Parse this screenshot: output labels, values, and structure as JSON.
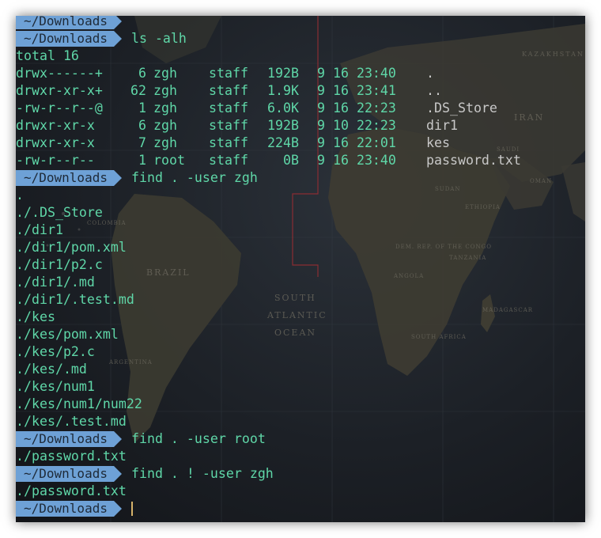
{
  "window": {
    "title": ""
  },
  "prompt": {
    "label": "~/Downloads"
  },
  "lines": [
    {
      "kind": "prompt",
      "command": ""
    },
    {
      "kind": "prompt",
      "command": "ls -alh"
    },
    {
      "kind": "text",
      "text": "total 16"
    },
    {
      "kind": "ls",
      "perm": "drwx------+",
      "links": "6",
      "user": "zgh",
      "group": "staff",
      "size": "192B",
      "date": "9 16 23:40",
      "name": "."
    },
    {
      "kind": "ls",
      "perm": "drwxr-xr-x+",
      "links": "62",
      "user": "zgh",
      "group": "staff",
      "size": "1.9K",
      "date": "9 16 23:41",
      "name": ".."
    },
    {
      "kind": "ls",
      "perm": "-rw-r--r--@",
      "links": "1",
      "user": "zgh",
      "group": "staff",
      "size": "6.0K",
      "date": "9 16 22:23",
      "name": ".DS_Store"
    },
    {
      "kind": "ls",
      "perm": "drwxr-xr-x",
      "links": "6",
      "user": "zgh",
      "group": "staff",
      "size": "192B",
      "date": "9 10 22:23",
      "name": "dir1"
    },
    {
      "kind": "ls",
      "perm": "drwxr-xr-x",
      "links": "7",
      "user": "zgh",
      "group": "staff",
      "size": "224B",
      "date": "9 16 22:01",
      "name": "kes"
    },
    {
      "kind": "ls",
      "perm": "-rw-r--r--",
      "links": "1",
      "user": "root",
      "group": "staff",
      "size": "0B",
      "date": "9 16 23:40",
      "name": "password.txt"
    },
    {
      "kind": "prompt",
      "command": "find . -user zgh"
    },
    {
      "kind": "text",
      "text": "."
    },
    {
      "kind": "text",
      "text": "./.DS_Store"
    },
    {
      "kind": "text",
      "text": "./dir1"
    },
    {
      "kind": "text",
      "text": "./dir1/pom.xml"
    },
    {
      "kind": "text",
      "text": "./dir1/p2.c"
    },
    {
      "kind": "text",
      "text": "./dir1/.md"
    },
    {
      "kind": "text",
      "text": "./dir1/.test.md"
    },
    {
      "kind": "text",
      "text": "./kes"
    },
    {
      "kind": "text",
      "text": "./kes/pom.xml"
    },
    {
      "kind": "text",
      "text": "./kes/p2.c"
    },
    {
      "kind": "text",
      "text": "./kes/.md"
    },
    {
      "kind": "text",
      "text": "./kes/num1"
    },
    {
      "kind": "text",
      "text": "./kes/num1/num22"
    },
    {
      "kind": "text",
      "text": "./kes/.test.md"
    },
    {
      "kind": "prompt",
      "command": "find . -user root"
    },
    {
      "kind": "text",
      "text": "./password.txt"
    },
    {
      "kind": "prompt",
      "command": "find . ! -user zgh"
    },
    {
      "kind": "text",
      "text": "./password.txt"
    },
    {
      "kind": "prompt",
      "command": "",
      "cursor": true
    }
  ],
  "map_labels": [
    "KAZAKHSTAN",
    "IRAN",
    "SUDAN",
    "ETHIOPIA",
    "BRAZIL",
    "SOUTH",
    "ATLANTIC",
    "OCEAN",
    "COLOMBIA",
    "ANGOLA",
    "ARGENTINA",
    "DEM. REP. OF THE CONGO",
    "TANZANIA",
    "MADAGASCAR",
    "SOUTH AFRICA",
    "SAUDI",
    "OMAN"
  ],
  "colors": {
    "prompt_bg": "#6ea1d6",
    "prompt_fg": "#1e2a38",
    "text": "#5fd7a8",
    "filename": "#c8c8c8",
    "cursor": "#d6b26a",
    "background": "#1c2026"
  }
}
